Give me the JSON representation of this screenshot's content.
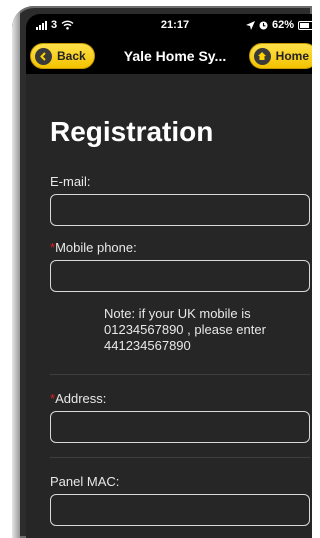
{
  "status_bar": {
    "carrier": "3",
    "time": "21:17",
    "battery_percent": "62%",
    "battery_level": 0.62,
    "icons": [
      "signal-icon",
      "wifi-icon",
      "location-arrow-icon",
      "alarm-icon",
      "battery-icon"
    ]
  },
  "nav": {
    "back_label": "Back",
    "title": "Yale Home Sy...",
    "home_label": "Home"
  },
  "page": {
    "title": "Registration"
  },
  "form": {
    "email_label": "E-mail:",
    "mobile_label": "Mobile phone:",
    "mobile_note": "Note: if your UK mobile is 01234567890 , please enter 441234567890",
    "address_label": "Address:",
    "panel_mac_label": "Panel MAC:",
    "required_marker": "*"
  },
  "colors": {
    "accent": "#f3c200",
    "background": "#262626",
    "required": "#e02020"
  }
}
